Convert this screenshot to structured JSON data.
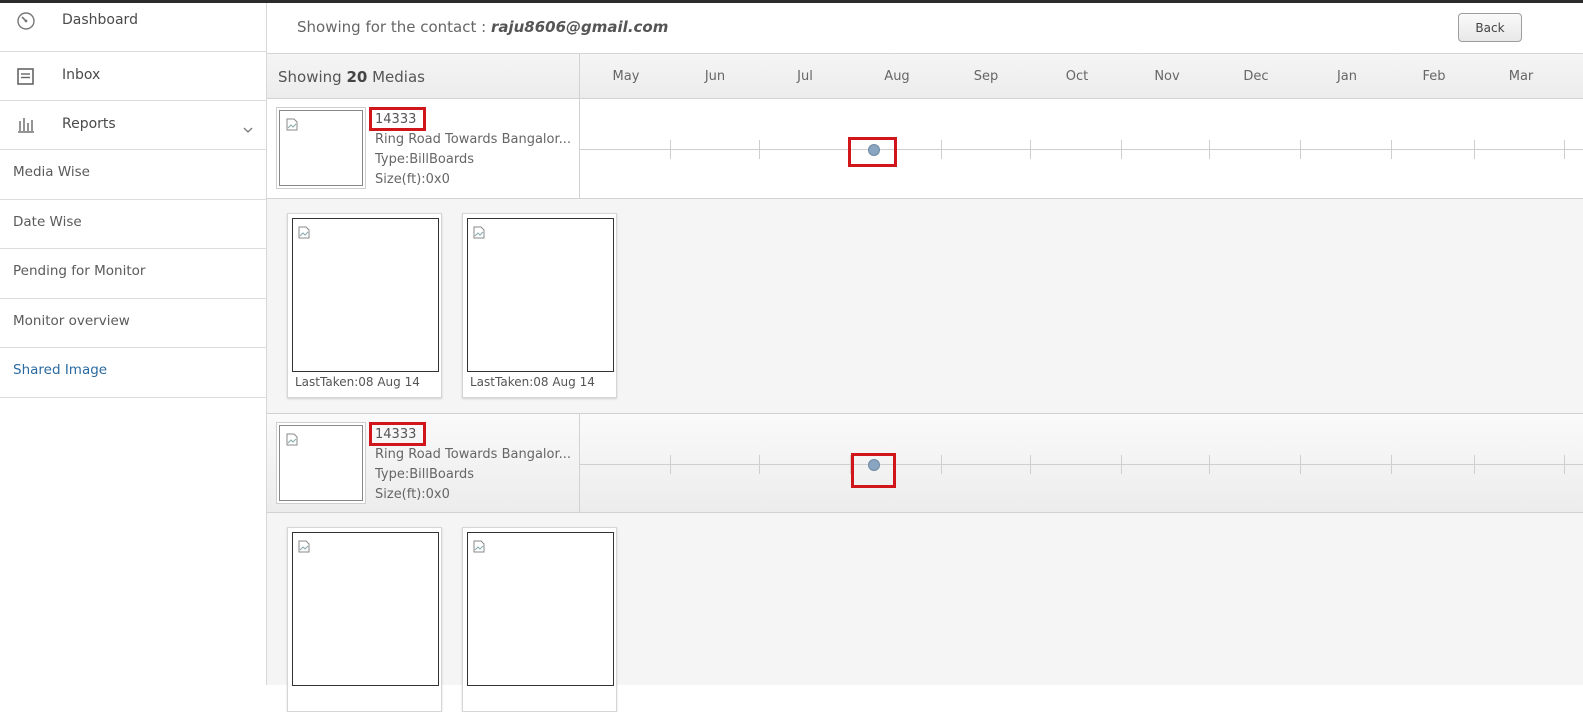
{
  "sidebar": {
    "items": [
      {
        "label": "Dashboard",
        "icon": "speedometer-icon"
      },
      {
        "label": "Inbox",
        "icon": "inbox-icon"
      },
      {
        "label": "Reports",
        "icon": "bar-chart-icon",
        "expanded": true
      }
    ],
    "subitems": [
      {
        "label": "Media Wise",
        "active": false
      },
      {
        "label": "Date Wise",
        "active": false
      },
      {
        "label": "Pending for Monitor",
        "active": false
      },
      {
        "label": "Monitor overview",
        "active": false
      },
      {
        "label": "Shared Image",
        "active": true
      }
    ]
  },
  "header": {
    "contact_prefix": "Showing for the contact : ",
    "contact_email": "raju8606@gmail.com",
    "back_label": "Back"
  },
  "list_header": {
    "showing_prefix": "Showing ",
    "count": "20",
    "showing_suffix": " Medias",
    "months": [
      "May",
      "Jun",
      "Jul",
      "Aug",
      "Sep",
      "Oct",
      "Nov",
      "Dec",
      "Jan",
      "Feb",
      "Mar"
    ]
  },
  "media": [
    {
      "id": "14333",
      "name": "Ring Road Towards Bangalor...",
      "type": "Type:BillBoards",
      "size": "Size(ft):0x0",
      "marker_month": "Aug",
      "images": [
        {
          "caption": "LastTaken:08 Aug 14"
        },
        {
          "caption": "LastTaken:08 Aug 14"
        }
      ]
    },
    {
      "id": "14333",
      "name": "Ring Road Towards Bangalor...",
      "type": "Type:BillBoards",
      "size": "Size(ft):0x0",
      "marker_month": "Aug",
      "images": [
        {
          "caption": ""
        },
        {
          "caption": ""
        }
      ]
    }
  ],
  "colors": {
    "highlight": "#d0161b",
    "active_link": "#2a6aa0",
    "marker": "#8aa5bf"
  }
}
